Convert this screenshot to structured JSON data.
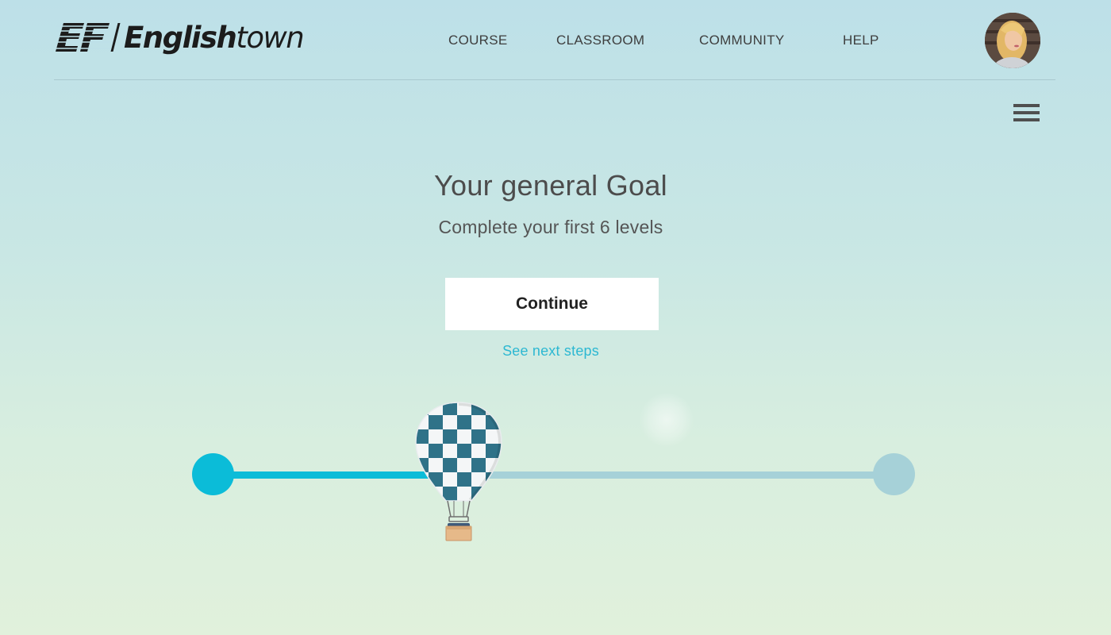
{
  "header": {
    "logo": {
      "mark_text": "EF",
      "brand_bold": "English",
      "brand_light": "town"
    },
    "nav": [
      {
        "label": "COURSE"
      },
      {
        "label": "CLASSROOM"
      },
      {
        "label": "COMMUNITY"
      },
      {
        "label": "HELP"
      }
    ]
  },
  "goal": {
    "title": "Your general Goal",
    "subtitle": "Complete your first 6 levels",
    "continue_label": "Continue",
    "next_steps_label": "See next steps"
  },
  "progress": {
    "fraction": 0.36
  },
  "icons": {
    "menu": "hamburger-menu-icon",
    "balloon": "hot-air-balloon-icon",
    "avatar": "user-avatar"
  },
  "colors": {
    "accent": "#0bbcd8",
    "link": "#2cb8d2",
    "track_remaining": "#a6d1d8",
    "balloon_teal": "#2f7288"
  }
}
